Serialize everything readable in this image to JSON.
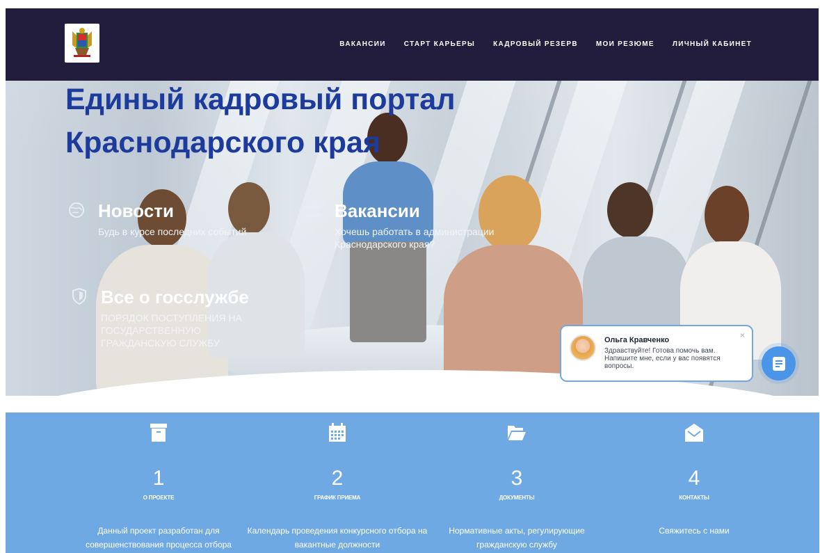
{
  "navbar": {
    "logo_alt": "Герб Краснодарского края",
    "links": [
      {
        "label": "ВАКАНСИИ"
      },
      {
        "label": "СТАРТ КАРЬЕРЫ"
      },
      {
        "label": "КАДРОВЫЙ РЕЗЕРВ"
      },
      {
        "label": "МОИ РЕЗЮМЕ"
      },
      {
        "label": "ЛИЧНЫЙ КАБИНЕТ"
      }
    ]
  },
  "hero": {
    "title_line1": "Единый кадровый портал",
    "title_line2": "Краснодарского края",
    "features": [
      {
        "icon": "globe-icon",
        "title": "Новости",
        "text": "Будь в курсе последних событий"
      },
      {
        "icon": "users-icon",
        "title": "Вакансии",
        "text": "Хочешь работать в администрации Краснодарского края?"
      },
      {
        "icon": "shield-icon",
        "title": "Все о госслужбе",
        "text": "ПОРЯДОК ПОСТУПЛЕНИЯ НА ГОСУДАРСТВЕННУЮ ГРАЖДАНСКУЮ СЛУЖБУ"
      }
    ]
  },
  "chat": {
    "name": "Ольга Кравченко",
    "message": "Здравствуйте! Готова помочь вам. Напишите мне, если у вас появятся вопросы.",
    "close": "×"
  },
  "info": {
    "columns": [
      {
        "icon": "archive-icon",
        "number": "1",
        "label": "О ПРОЕКТЕ",
        "text": "Данный проект разработан для совершенствования процесса отбора"
      },
      {
        "icon": "calendar-icon",
        "number": "2",
        "label": "ГРАФИК ПРИЕМА",
        "text": "Календарь проведения конкурсного отбора на вакантные должности"
      },
      {
        "icon": "folder-open-icon",
        "number": "3",
        "label": "ДОКУМЕНТЫ",
        "text": "Нормативные акты, регулирующие гражданскую службу"
      },
      {
        "icon": "envelope-open-icon",
        "number": "4",
        "label": "КОНТАКТЫ",
        "text": "Свяжитесь с нами"
      }
    ]
  },
  "colors": {
    "nav_bg": "#221d3c",
    "title": "#1c3b9c",
    "info_bg": "#6fa9e3",
    "chat_accent": "#4a95e8"
  }
}
